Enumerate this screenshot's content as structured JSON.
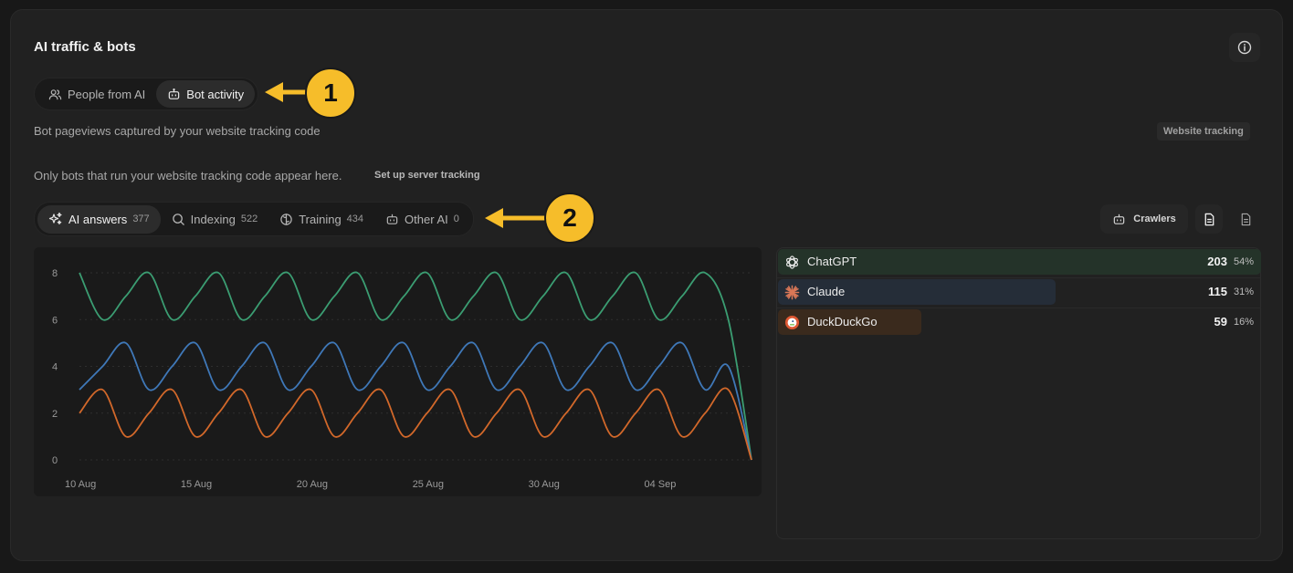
{
  "header": {
    "title": "AI traffic & bots",
    "info_icon": "info-icon"
  },
  "mode_tabs": [
    {
      "label": "People from AI",
      "icon": "people-icon",
      "active": false
    },
    {
      "label": "Bot activity",
      "icon": "bot-icon",
      "active": true
    }
  ],
  "subtitle": "Bot pageviews captured by your website tracking code",
  "tracking_badge": "Website tracking",
  "note": "Only bots that run your website tracking code appear here.",
  "note_link": "Set up server tracking",
  "category_tabs": [
    {
      "label": "AI answers",
      "count": "377",
      "icon": "sparkles-icon",
      "active": true
    },
    {
      "label": "Indexing",
      "count": "522",
      "icon": "search-icon",
      "active": false
    },
    {
      "label": "Training",
      "count": "434",
      "icon": "training-icon",
      "active": false
    },
    {
      "label": "Other AI",
      "count": "0",
      "icon": "bot-icon",
      "active": false
    }
  ],
  "toolbar": {
    "crawlers_label": "Crawlers",
    "crawlers_icon": "bot-icon",
    "doc_icon": "document-icon",
    "doc_outline_icon": "document-outline-icon"
  },
  "callouts": {
    "one": "1",
    "two": "2"
  },
  "bots": [
    {
      "name": "ChatGPT",
      "value": "203",
      "percent": "54%",
      "share": 0.54,
      "color": "#243329",
      "icon": "chatgpt-icon"
    },
    {
      "name": "Claude",
      "value": "115",
      "percent": "31%",
      "share": 0.31,
      "color": "#252d38",
      "icon": "claude-icon"
    },
    {
      "name": "DuckDuckGo",
      "value": "59",
      "percent": "16%",
      "share": 0.16,
      "color": "#3a2a1d",
      "icon": "duckduckgo-icon"
    }
  ],
  "colors": {
    "chatgpt": "#3b9d72",
    "claude": "#3f78b8",
    "duckduckgo": "#d2682a",
    "accent": "#f6bd2a"
  },
  "chart_data": {
    "type": "line",
    "x_tick_labels": [
      "10 Aug",
      "15 Aug",
      "20 Aug",
      "25 Aug",
      "30 Aug",
      "04 Sep"
    ],
    "x_tick_days": [
      0,
      5,
      10,
      15,
      20,
      25
    ],
    "y_ticks": [
      0,
      2,
      4,
      6,
      8
    ],
    "ylim": [
      0,
      8
    ],
    "x": [
      0,
      1,
      2,
      3,
      4,
      5,
      6,
      7,
      8,
      9,
      10,
      11,
      12,
      13,
      14,
      15,
      16,
      17,
      18,
      19,
      20,
      21,
      22,
      23,
      24,
      25,
      26,
      27,
      28,
      29
    ],
    "series": [
      {
        "name": "ChatGPT",
        "color": "#3b9d72",
        "values": [
          8,
          6,
          7,
          8,
          6,
          7,
          8,
          6,
          7,
          8,
          6,
          7,
          8,
          6,
          7,
          8,
          6,
          7,
          8,
          6,
          7,
          8,
          6,
          7,
          8,
          6,
          7,
          8,
          6,
          0
        ]
      },
      {
        "name": "Claude",
        "color": "#3f78b8",
        "values": [
          3,
          4,
          5,
          3,
          4,
          5,
          3,
          4,
          5,
          3,
          4,
          5,
          3,
          4,
          5,
          3,
          4,
          5,
          3,
          4,
          5,
          3,
          4,
          5,
          3,
          4,
          5,
          3,
          4,
          0
        ]
      },
      {
        "name": "DuckDuckGo",
        "color": "#d2682a",
        "values": [
          2,
          3,
          1,
          2,
          3,
          1,
          2,
          3,
          1,
          2,
          3,
          1,
          2,
          3,
          1,
          2,
          3,
          1,
          2,
          3,
          1,
          2,
          3,
          1,
          2,
          3,
          1,
          2,
          3,
          0
        ]
      }
    ],
    "grid": true,
    "legend": "none"
  }
}
